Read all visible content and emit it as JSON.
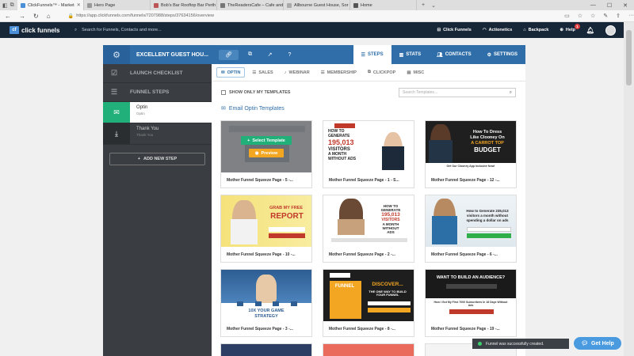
{
  "browser": {
    "tabs": [
      {
        "title": "ClickFunnels™ - Market",
        "active": true
      },
      {
        "title": "Hero Page",
        "active": false
      },
      {
        "title": "Bob's Bar Rooftop Bar Perth",
        "active": false
      },
      {
        "title": "TheReadersCafe – Cafe and",
        "active": false
      },
      {
        "title": "Allbourne Guest House, Sor",
        "active": false
      },
      {
        "title": "Home",
        "active": false
      }
    ],
    "url": "https://app.clickfunnels.com/funnels/7207988/steps/37634156/overview"
  },
  "cfnav": {
    "logo_text": "click funnels",
    "search_placeholder": "Search for Funnels, Contacts and more...",
    "links": [
      {
        "label": "Click Funnels",
        "icon": "funnel-icon"
      },
      {
        "label": "Actionetics",
        "icon": "headset-icon"
      },
      {
        "label": "Backpack",
        "icon": "backpack-icon"
      },
      {
        "label": "Help",
        "icon": "help-icon"
      }
    ],
    "help_badge": "1"
  },
  "funnel": {
    "title": "EXCELLENT GUEST HOU...",
    "tabs": [
      {
        "label": "STEPS",
        "active": true
      },
      {
        "label": "STATS",
        "active": false
      },
      {
        "label": "CONTACTS",
        "active": false
      },
      {
        "label": "SETTINGS",
        "active": false
      }
    ]
  },
  "sidebar": {
    "launch_checklist": "LAUNCH CHECKLIST",
    "funnel_steps": "FUNNEL STEPS",
    "steps": [
      {
        "name": "Optin",
        "type": "Optin",
        "active": true
      },
      {
        "name": "Thank You",
        "type": "Thank You",
        "active": false
      }
    ],
    "add_step": "ADD NEW STEP"
  },
  "main": {
    "subtabs": [
      {
        "label": "OPTIN",
        "active": true
      },
      {
        "label": "SALES",
        "active": false
      },
      {
        "label": "WEBINAR",
        "active": false
      },
      {
        "label": "MEMBERSHIP",
        "active": false
      },
      {
        "label": "CLICKPOP",
        "active": false
      },
      {
        "label": "MISC",
        "active": false
      }
    ],
    "show_mine": "SHOW ONLY MY TEMPLATES",
    "search_placeholder": "Search Templates...",
    "section_title": "Email Optin Templates",
    "select_label": "Select Template",
    "preview_label": "Preview",
    "templates": [
      {
        "caption": "Mother Funnel Squeeze Page - 5 -..."
      },
      {
        "caption": "Mother Funnel Squeeze Page - 1 - S..."
      },
      {
        "caption": "Mother Funnel Squeeze Page - 12 -..."
      },
      {
        "caption": "Mother Funnel Squeeze Page - 10 -..."
      },
      {
        "caption": "Mother Funnel Squeeze Page - 2 -..."
      },
      {
        "caption": "Mother Funnel Squeeze Page - 6 -..."
      },
      {
        "caption": "Mother Funnel Squeeze Page - 3 -..."
      },
      {
        "caption": "Mother Funnel Squeeze Page - 8 -..."
      },
      {
        "caption": "Mother Funnel Squeeze Page - 19 -..."
      }
    ],
    "thumb_text": {
      "t2": [
        "HOW TO",
        "GENERATE",
        "195,013",
        "VISITORS",
        "A MONTH",
        "WITHOUT ADS"
      ],
      "t3": [
        "How To Dress",
        "Like Clooney On",
        "A CARROT TOP",
        "BUDGET"
      ],
      "t3_cta": "Get Our Clooney App Inclusive Now!",
      "t4": [
        "GRAB MY FREE",
        "REPORT"
      ],
      "t5": [
        "HOW TO",
        "GENERATE",
        "195,013",
        "VISITORS",
        "A MONTH",
        "WITHOUT",
        "ADS"
      ],
      "t6": [
        "How to Generate 235,013",
        "visitors a month without",
        "spending a dollar on ads"
      ],
      "t7": [
        "10X YOUR GAME",
        "STRATEGY"
      ],
      "t8_brand": "FUNNEL",
      "t8": [
        "DISCOVER...",
        "THE ONE WAY TO BUILD YOUR FUNNEL"
      ],
      "t9": [
        "WANT TO BUILD AN AUDIENCE?"
      ],
      "t9_sub": "How I Got My First 7000 Subscribers In 18 Days Without Ads"
    }
  },
  "toast": "Funnel was successfully created.",
  "get_help": "Get Help",
  "colors": {
    "nav_bg": "#182738",
    "funnel_header": "#2f6ea8",
    "sidebar_bg": "#3a3d41",
    "active_green": "#21b07a",
    "preview_orange": "#f3a622",
    "help_blue": "#4a9ae0"
  }
}
